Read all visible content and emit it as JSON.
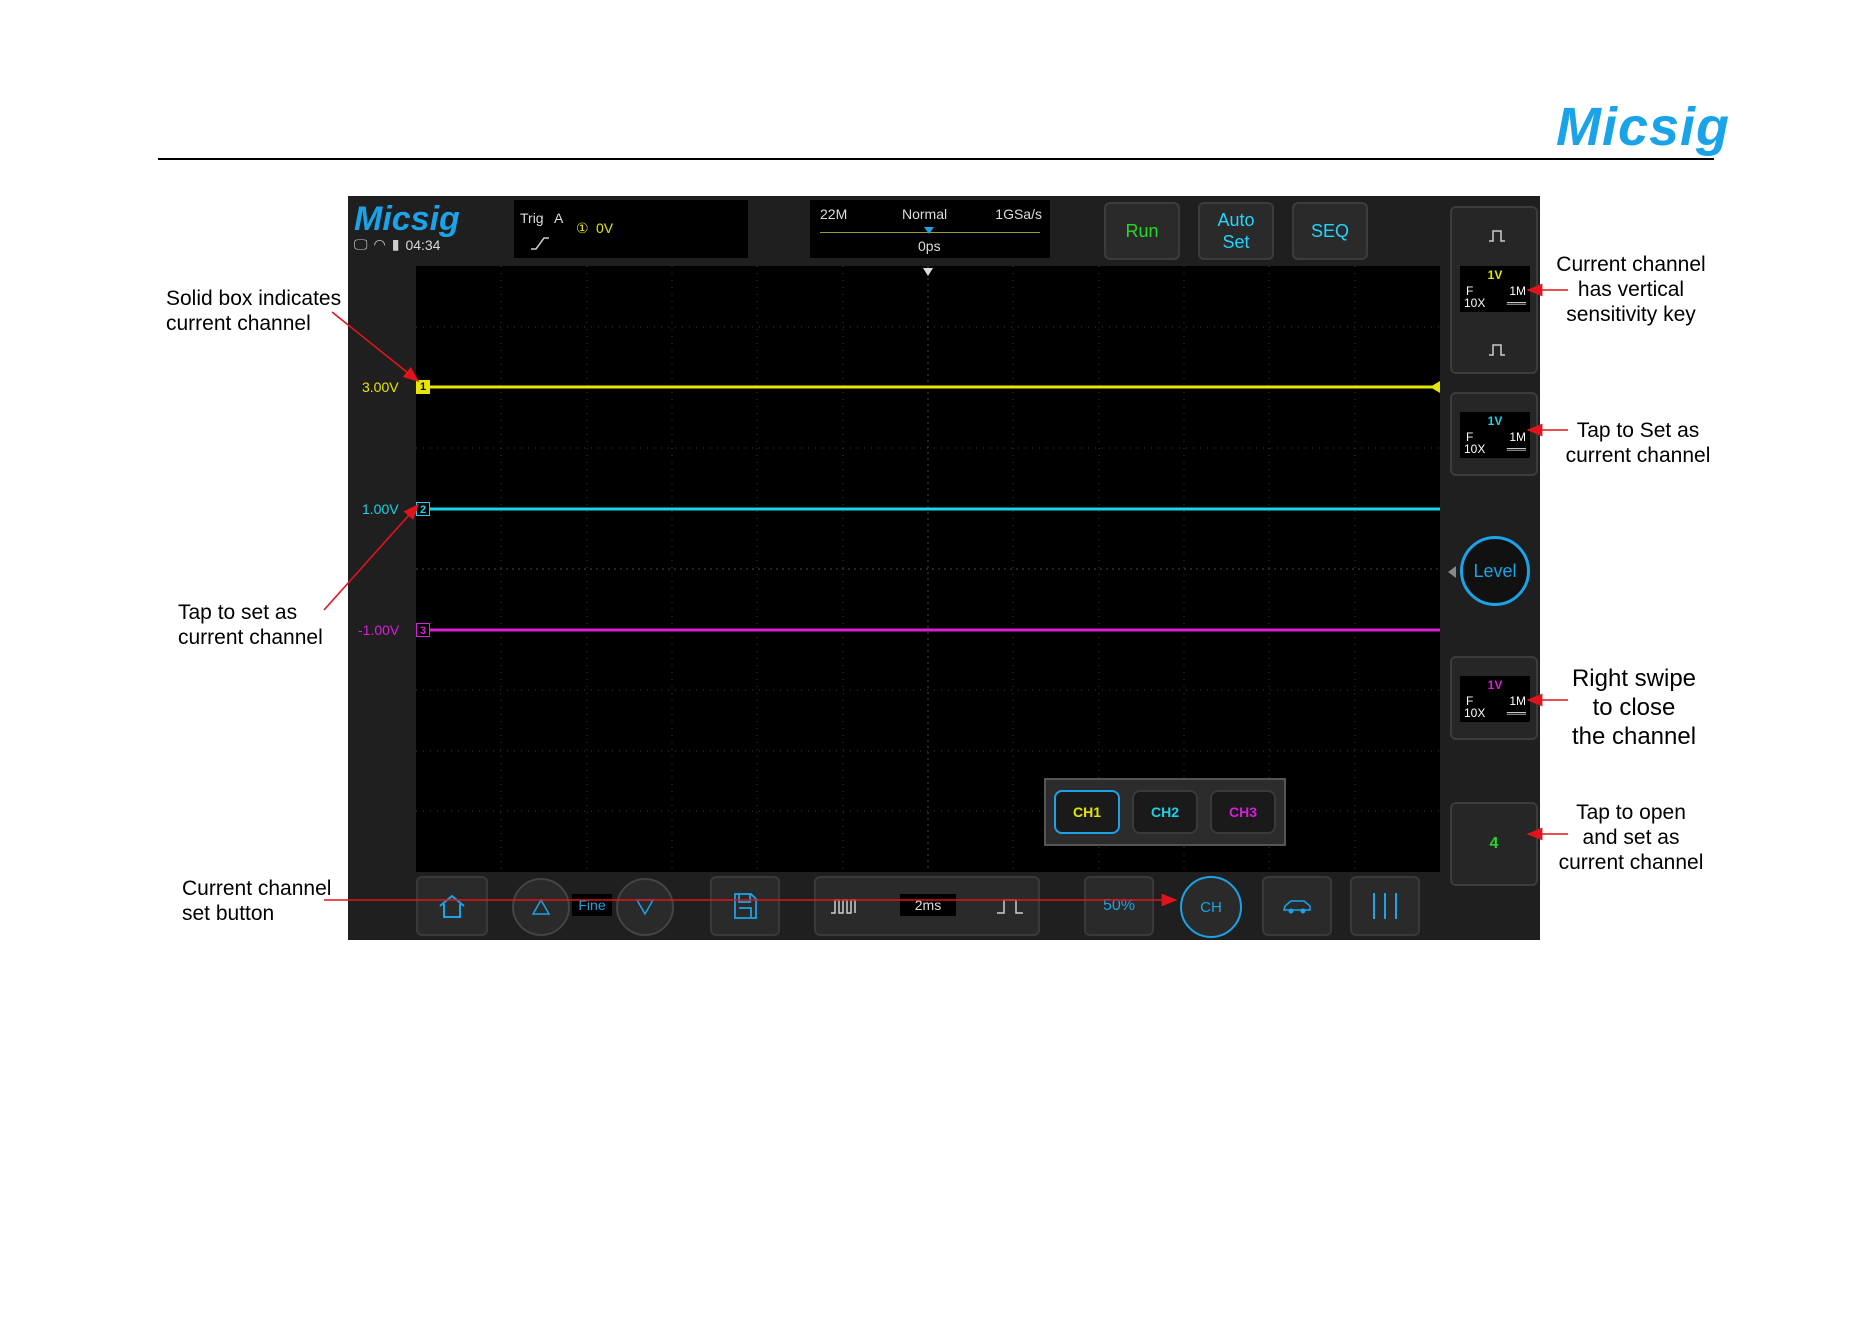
{
  "header": {
    "brand": "Micsig"
  },
  "scope": {
    "brand": "Micsig",
    "time": "04:34",
    "trigger": {
      "label": "Trig",
      "source": "A",
      "channel_symbol": "①",
      "level": "0V"
    },
    "timebase": {
      "memory": "22M",
      "mode": "Normal",
      "sample_rate": "1GSa/s",
      "offset": "0ps"
    },
    "buttons": {
      "run": "Run",
      "auto_set_1": "Auto",
      "auto_set_2": "Set",
      "seq": "SEQ"
    },
    "channels": [
      {
        "name": "CH1",
        "marker": "1",
        "offset_label": "3.00V",
        "color": "#e6e600"
      },
      {
        "name": "CH2",
        "marker": "2",
        "offset_label": "1.00V",
        "color": "#19d4e8"
      },
      {
        "name": "CH3",
        "marker": "3",
        "offset_label": "-1.00V",
        "color": "#d81fd8"
      }
    ],
    "channel_keys": [
      {
        "volts": "1V",
        "coupling": "F",
        "probe": "10X",
        "impedance": "1M",
        "dc_symbol": "═══",
        "color": "#e6e600"
      },
      {
        "volts": "1V",
        "coupling": "F",
        "probe": "10X",
        "impedance": "1M",
        "dc_symbol": "═══",
        "color": "#19d4e8"
      },
      {
        "volts": "1V",
        "coupling": "F",
        "probe": "10X",
        "impedance": "1M",
        "dc_symbol": "═══",
        "color": "#d81fd8"
      }
    ],
    "level_button": "Level",
    "ch4_button": "4",
    "bottom": {
      "fine": "Fine",
      "timescale": "2ms",
      "fifty": "50%",
      "ch_set": "CH"
    }
  },
  "annotations": {
    "solid_box_1": "Solid box indicates",
    "solid_box_2": "current channel",
    "tap_set_1": "Tap to set as",
    "tap_set_2": "current channel",
    "cur_btn_1": "Current channel",
    "cur_btn_2": "set button",
    "vert_key_1": "Current channel",
    "vert_key_2": "has vertical",
    "vert_key_3": "sensitivity key",
    "tap_set_r_1": "Tap to Set as",
    "tap_set_r_2": "current channel",
    "swipe_1": "Right swipe",
    "swipe_2": "to close",
    "swipe_3": "the channel",
    "open_1": "Tap to open",
    "open_2": "and set as",
    "open_3": "current channel"
  },
  "colors": {
    "accent": "#1aa3e8",
    "arrow": "#e0141b",
    "run_green": "#29d629"
  }
}
